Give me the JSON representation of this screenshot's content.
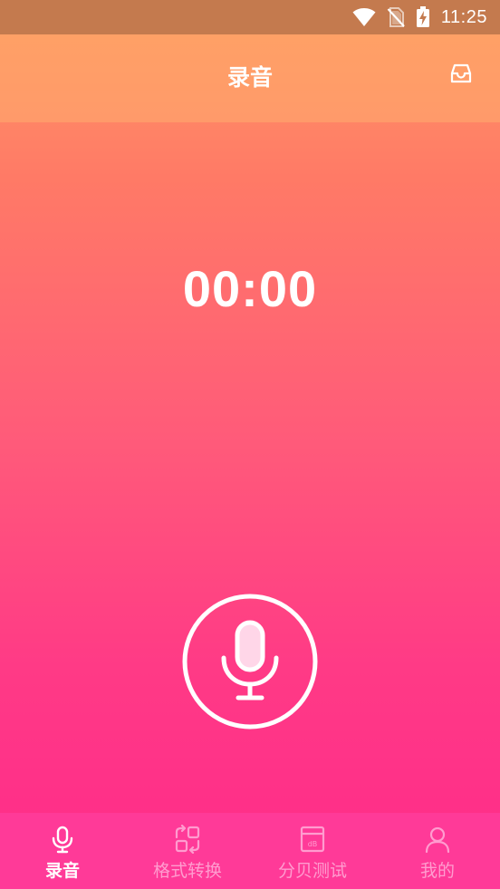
{
  "status_bar": {
    "time": "11:25",
    "icons": [
      "wifi-icon",
      "no-sim-icon",
      "battery-charging-icon"
    ]
  },
  "header": {
    "title": "录音",
    "action_icon": "inbox-icon"
  },
  "recorder": {
    "elapsed": "00:00",
    "record_icon": "microphone-icon"
  },
  "tabs": [
    {
      "label": "录音",
      "icon": "microphone-icon",
      "active": true
    },
    {
      "label": "格式转换",
      "icon": "convert-icon",
      "active": false
    },
    {
      "label": "分贝测试",
      "icon": "decibel-meter-icon",
      "active": false
    },
    {
      "label": "我的",
      "icon": "profile-icon",
      "active": false
    }
  ],
  "colors": {
    "status_bar": "#c47a4e",
    "gradient_top": "#ff9a64",
    "gradient_bottom": "#ff2a8a",
    "tabbar": "#ff3a98",
    "tab_inactive": "#ff9ccf",
    "tab_active": "#ffffff"
  }
}
